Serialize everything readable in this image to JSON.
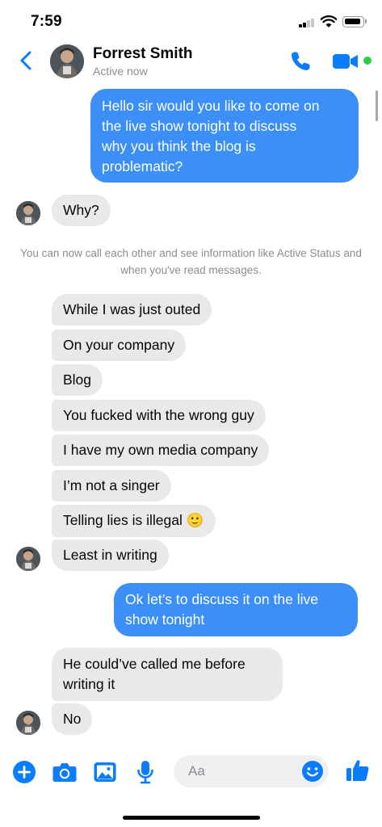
{
  "status_bar": {
    "time": "7:59"
  },
  "header": {
    "contact_name": "Forrest Smith",
    "contact_status": "Active now",
    "back_icon": "chevron-left-icon",
    "call_icon": "phone-icon",
    "video_icon": "video-camera-icon"
  },
  "messages": [
    {
      "direction": "out",
      "text_lines": [
        "Hello sir would you like to come on",
        "the live show tonight to discuss",
        "why you think the blog is",
        "problematic?"
      ]
    },
    {
      "direction": "in",
      "text": "Why?"
    },
    {
      "direction": "system",
      "text": "You can now call each other and see information like Active Status and when you've read messages."
    },
    {
      "direction": "in",
      "text": "While I was just outed"
    },
    {
      "direction": "in",
      "text": "On your company"
    },
    {
      "direction": "in",
      "text": "Blog"
    },
    {
      "direction": "in",
      "text": "You fucked with the wrong guy"
    },
    {
      "direction": "in",
      "text": "I have my own media company"
    },
    {
      "direction": "in",
      "text": "I’m not a singer"
    },
    {
      "direction": "in",
      "text": "Telling lies is illegal",
      "emoji": "🙂"
    },
    {
      "direction": "in",
      "text": "Least in writing"
    },
    {
      "direction": "out",
      "text_lines": [
        "Ok let’s to discuss it on the live",
        "show tonight"
      ]
    },
    {
      "direction": "in",
      "text_lines": [
        "He could’ve called me before",
        "writing it"
      ]
    },
    {
      "direction": "in",
      "text": "No"
    }
  ],
  "composer": {
    "placeholder": "Aa",
    "icons": [
      "plus-icon",
      "camera-icon",
      "gallery-icon",
      "microphone-icon",
      "emoji-icon",
      "thumbs-up-icon"
    ]
  },
  "colors": {
    "accent": "#0a7cff",
    "outgoing_bubble": "#3b8ff6",
    "incoming_bubble": "#e9e9eb",
    "active_dot": "#31cc46"
  }
}
